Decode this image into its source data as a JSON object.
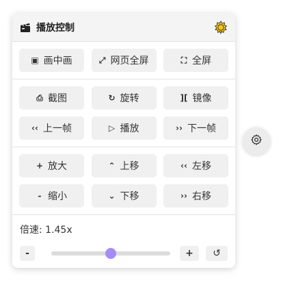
{
  "header": {
    "title": "播放控制",
    "title_icon": "clapperboard-icon",
    "theme_icon": "sun-icon"
  },
  "view_buttons": [
    {
      "label": "画中画",
      "icon": "▣"
    },
    {
      "label": "网页全屏",
      "icon": "⤢"
    },
    {
      "label": "全屏",
      "icon": "⛶"
    }
  ],
  "action_buttons": [
    {
      "label": "截图",
      "icon": "⎙"
    },
    {
      "label": "旋转",
      "icon": "↻"
    },
    {
      "label": "镜像",
      "icon": "]["
    },
    {
      "label": "上一帧",
      "icon": "‹‹"
    },
    {
      "label": "播放",
      "icon": "▷"
    },
    {
      "label": "下一帧",
      "icon": "››"
    }
  ],
  "transform_buttons": [
    {
      "label": "放大",
      "icon": "+"
    },
    {
      "label": "上移",
      "icon": "⌃"
    },
    {
      "label": "左移",
      "icon": "‹‹"
    },
    {
      "label": "缩小",
      "icon": "-"
    },
    {
      "label": "下移",
      "icon": "⌄"
    },
    {
      "label": "右移",
      "icon": "››"
    }
  ],
  "speed": {
    "label": "倍速: 1.45x",
    "decrease": "-",
    "increase": "+",
    "reset_icon": "↺",
    "value": 1.45,
    "slider_fraction": 0.5
  },
  "colors": {
    "accent": "#a58cf5",
    "button_bg": "#f0f0f0",
    "header_bg": "#f4f4f4"
  }
}
